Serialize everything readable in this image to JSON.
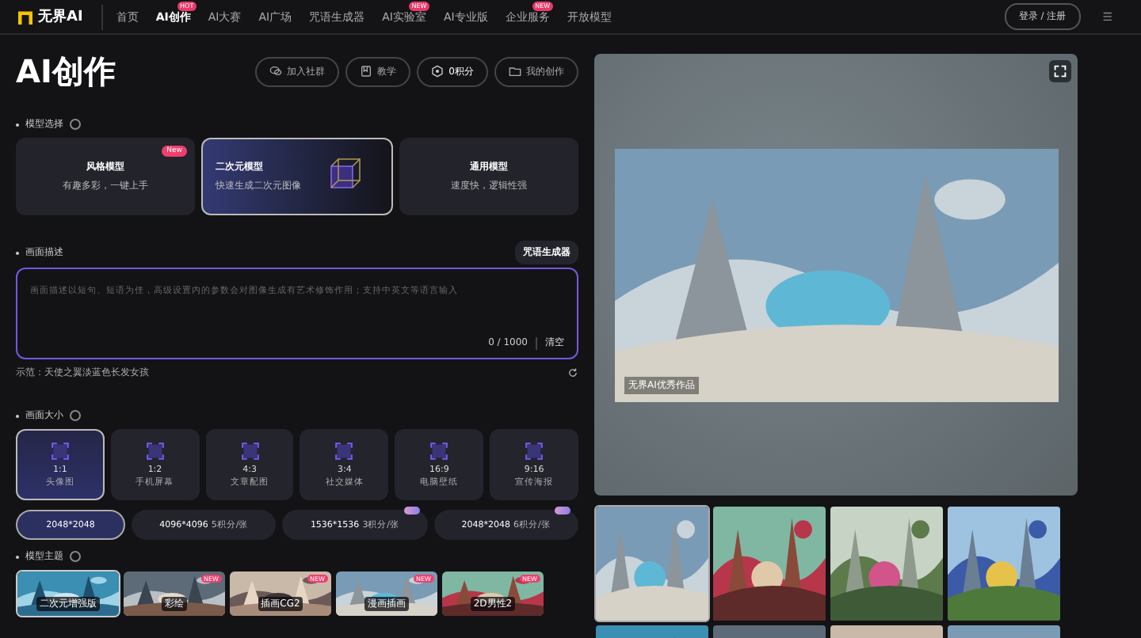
{
  "header": {
    "logo": "无界AI",
    "nav": [
      {
        "label": "首页",
        "selected": false
      },
      {
        "label": "AI创作",
        "selected": true,
        "badge": "HOT"
      },
      {
        "label": "AI大赛",
        "selected": false
      },
      {
        "label": "AI广场",
        "selected": false
      },
      {
        "label": "咒语生成器",
        "selected": false
      },
      {
        "label": "AI实验室",
        "selected": false,
        "badge": "NEW"
      },
      {
        "label": "AI专业版",
        "selected": false
      },
      {
        "label": "企业服务",
        "selected": false,
        "badge": "NEW"
      },
      {
        "label": "开放模型",
        "selected": false
      }
    ],
    "login": "登录 / 注册",
    "menu": "☰"
  },
  "title": "AI创作",
  "actions": [
    {
      "kind": "chat",
      "label": "加入社群"
    },
    {
      "kind": "book",
      "label": "教学"
    },
    {
      "kind": "coin",
      "label": "0积分"
    },
    {
      "kind": "folder",
      "label": "我的创作"
    }
  ],
  "model_section": {
    "label": "模型选择",
    "models": [
      {
        "name": "风格模型",
        "desc": "有趣多彩，一键上手",
        "selected": false,
        "badge": "New"
      },
      {
        "name": "二次元模型",
        "desc": "快速生成二次元图像",
        "selected": true
      },
      {
        "name": "通用模型",
        "desc": "速度快，逻辑性强",
        "selected": false
      }
    ]
  },
  "prompt": {
    "label": "画面描述",
    "generator": "咒语生成器",
    "placeholder": "画面描述以短句、短语为佳，高级设置内的参数会对图像生成有艺术修饰作用；支持中英文等语言输入",
    "count": "0 / 1000",
    "clear": "清空",
    "example": "示范：天使之翼淡蓝色长发女孩"
  },
  "size_section": {
    "label": "画面大小",
    "sizes": [
      {
        "ratio": "1:1",
        "name": "头像图",
        "selected": true
      },
      {
        "ratio": "1:2",
        "name": "手机屏幕",
        "selected": false
      },
      {
        "ratio": "4:3",
        "name": "文章配图",
        "selected": false
      },
      {
        "ratio": "3:4",
        "name": "社交媒体",
        "selected": false
      },
      {
        "ratio": "16:9",
        "name": "电脑壁纸",
        "selected": false
      },
      {
        "ratio": "9:16",
        "name": "宣传海报",
        "selected": false
      }
    ],
    "resolutions": [
      {
        "label": "2048*2048",
        "selected": true
      },
      {
        "label": "4096*4096",
        "cost": "5积分/张",
        "selected": false
      },
      {
        "label": "1536*1536",
        "cost": "3积分/张",
        "selected": false,
        "badge": true
      },
      {
        "label": "2048*2048",
        "cost": "6积分/张",
        "selected": false,
        "badge": true
      }
    ]
  },
  "theme_section": {
    "label": "模型主题",
    "themes": [
      {
        "name": "二次元增强版",
        "selected": true
      },
      {
        "name": "彩绘",
        "selected": false,
        "badge": "NEW"
      },
      {
        "name": "插画CG2",
        "selected": false,
        "badge": "NEW"
      },
      {
        "name": "漫画插画",
        "selected": false,
        "badge": "NEW"
      },
      {
        "name": "2D男性2",
        "selected": false,
        "badge": "NEW"
      }
    ]
  },
  "preview": {
    "caption": "无界AI优秀作品"
  },
  "gallery": [
    {
      "selected": true
    },
    {
      "selected": false
    },
    {
      "selected": false
    },
    {
      "selected": false
    },
    {
      "selected": false
    },
    {
      "selected": false
    },
    {
      "selected": false
    },
    {
      "selected": false
    }
  ]
}
